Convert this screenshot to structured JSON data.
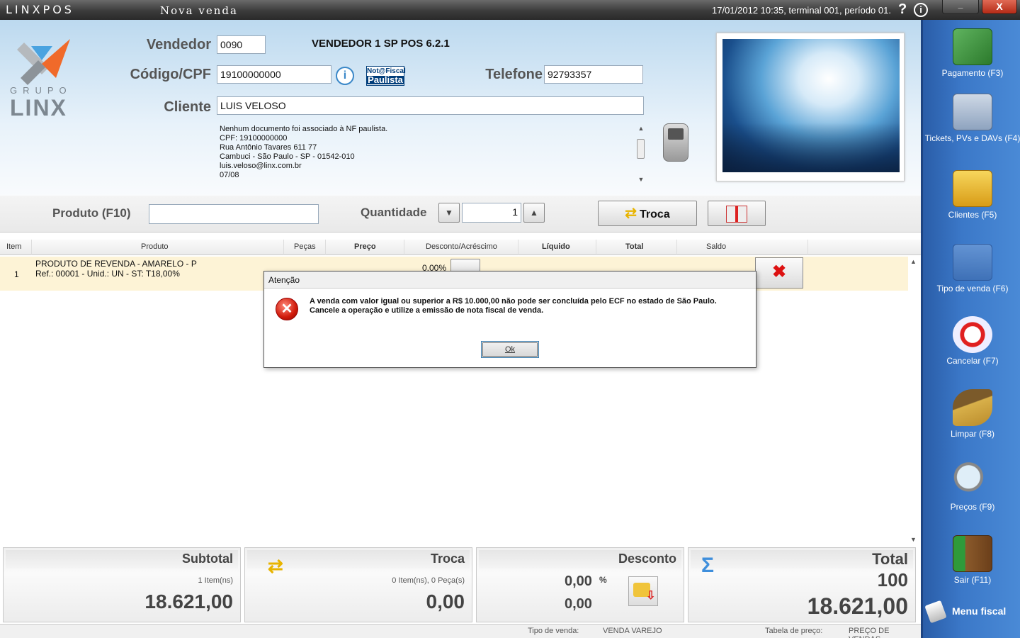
{
  "titlebar": {
    "brand": "LINXPOS",
    "window_title": "Nova venda",
    "info": "17/01/2012 10:35, terminal 001, período 01.",
    "help": "?",
    "info_icon": "i",
    "min_label": "_",
    "close_label": "X"
  },
  "logo": {
    "grupo": "GRUPO",
    "linx": "LINX"
  },
  "header": {
    "vendedor_label": "Vendedor",
    "vendedor_value": "0090",
    "vendedor_name": "VENDEDOR 1 SP POS 6.2.1",
    "cpf_label": "Código/CPF",
    "cpf_value": "19100000000",
    "nfp_top": "Not@Fiscal",
    "nfp_bottom": "Paulista",
    "telefone_label": "Telefone",
    "telefone_value": "92793357",
    "cliente_label": "Cliente",
    "cliente_value": "LUIS VELOSO",
    "notes": [
      "Nenhum documento foi associado à NF paulista.",
      "",
      "CPF: 19100000000",
      "Rua Antônio Tavares 611 77",
      "Cambuci - São Paulo - SP - 01542-010",
      "luis.veloso@linx.com.br",
      "07/08"
    ]
  },
  "product_bar": {
    "produto_label": "Produto (F10)",
    "produto_value": "",
    "quantidade_label": "Quantidade",
    "quantidade_value": "1",
    "troca_label": "Troca"
  },
  "grid": {
    "columns": [
      "Item",
      "Produto",
      "Peças",
      "Preço",
      "Desconto/Acréscimo",
      "Líquido",
      "Total",
      "Saldo"
    ],
    "rows": [
      {
        "item": "1",
        "line1": "PRODUTO DE REVENDA - AMARELO - P",
        "line2": "Ref.: 00001 - Unid.: UN - ST: T18,00%",
        "desconto": "0,00%"
      }
    ]
  },
  "dialog": {
    "title": "Atenção",
    "line1": "A venda com valor igual ou superior a R$ 10.000,00 não pode ser concluída pelo ECF no estado de São Paulo.",
    "line2": "Cancele a operação e utilize a emissão de nota fiscal de venda.",
    "ok_label": "Ok",
    "icon": "error-icon"
  },
  "sidebar": {
    "items": [
      {
        "label": "Pagamento (F3)",
        "icon": "payment-icon"
      },
      {
        "label": "Tickets, PVs e DAVs (F4)",
        "icon": "tickets-icon"
      },
      {
        "label": "Clientes (F5)",
        "icon": "clients-icon"
      },
      {
        "label": "Tipo de venda (F6)",
        "icon": "sale-type-icon"
      },
      {
        "label": "Cancelar (F7)",
        "icon": "cancel-icon"
      },
      {
        "label": "Limpar (F8)",
        "icon": "broom-icon"
      },
      {
        "label": "Preços (F9)",
        "icon": "magnifier-icon"
      },
      {
        "label": "Sair (F11)",
        "icon": "exit-door-icon"
      }
    ],
    "menu_fiscal": "Menu fiscal"
  },
  "footer": {
    "subtotal": {
      "title": "Subtotal",
      "items": "1 Item(ns)",
      "value": "18.621,00"
    },
    "troca": {
      "title": "Troca",
      "items": "0 Item(ns), 0 Peça(s)",
      "value": "0,00"
    },
    "desconto": {
      "title": "Desconto",
      "percent": "0,00",
      "percent_sign": "%",
      "value": "0,00"
    },
    "total": {
      "title": "Total",
      "pieces": "100",
      "value": "18.621,00"
    }
  },
  "statusbar": {
    "tipo_label": "Tipo de venda:",
    "tipo_value": "VENDA VAREJO",
    "tabela_label": "Tabela de preço:",
    "tabela_value": "PREÇO DE VENDAS"
  },
  "colors": {
    "sidebar": "#3b78c8",
    "error": "#d01a0a",
    "row_highlight": "#fdf3d6"
  }
}
